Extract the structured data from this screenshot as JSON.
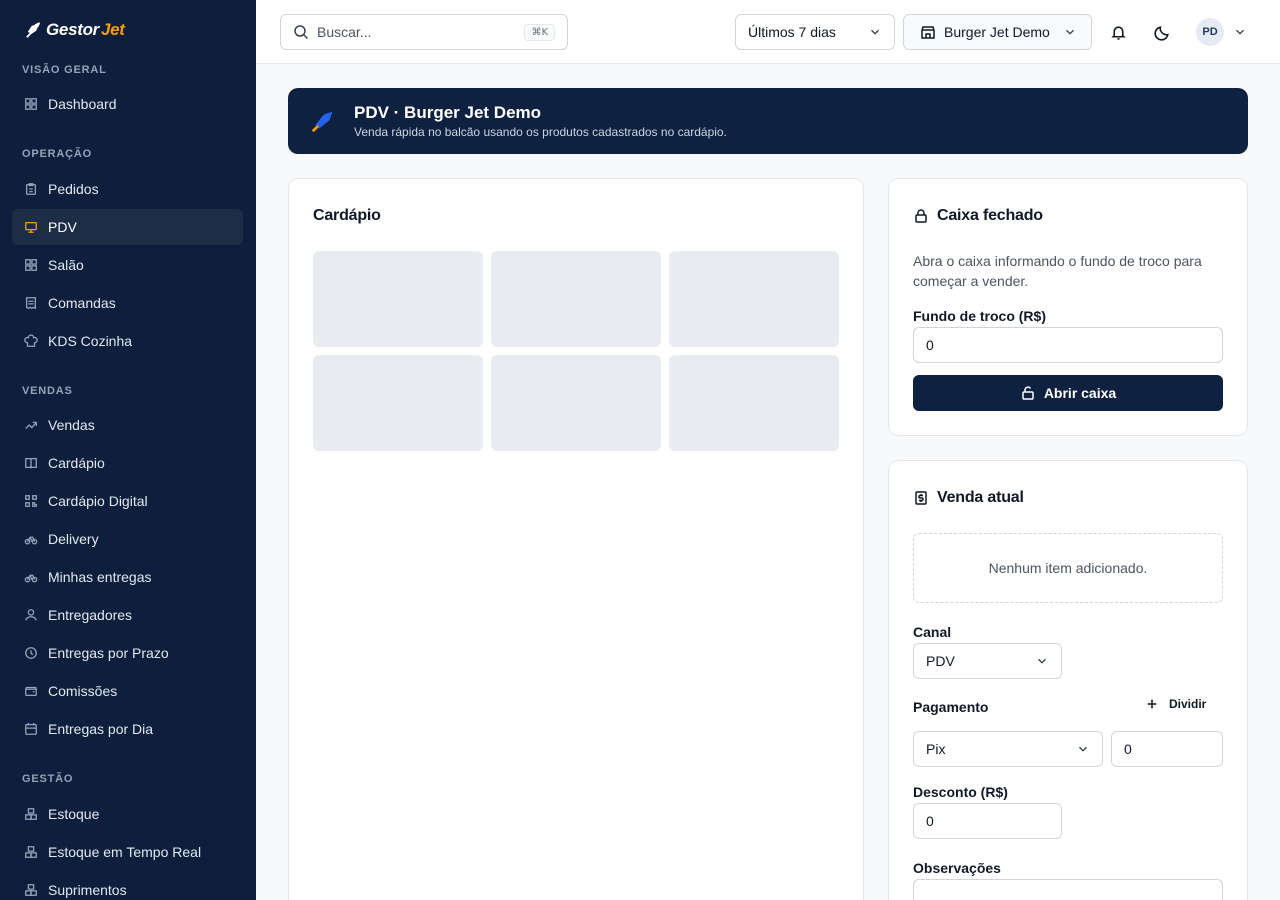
{
  "brand": {
    "name_part1": "Gestor",
    "name_part2": "Jet"
  },
  "sidebar": {
    "sections": [
      {
        "label": "VISÃO GERAL",
        "items": [
          {
            "label": "Dashboard",
            "icon": "dashboard-icon"
          }
        ]
      },
      {
        "label": "OPERAÇÃO",
        "items": [
          {
            "label": "Pedidos",
            "icon": "clipboard-icon"
          },
          {
            "label": "PDV",
            "icon": "monitor-icon",
            "active": true
          },
          {
            "label": "Salão",
            "icon": "grid-icon"
          },
          {
            "label": "Comandas",
            "icon": "receipt-icon"
          },
          {
            "label": "KDS Cozinha",
            "icon": "chef-hat-icon"
          }
        ]
      },
      {
        "label": "VENDAS",
        "items": [
          {
            "label": "Vendas",
            "icon": "trend-icon"
          },
          {
            "label": "Cardápio",
            "icon": "book-icon"
          },
          {
            "label": "Cardápio Digital",
            "icon": "qr-icon"
          },
          {
            "label": "Delivery",
            "icon": "bike-icon"
          },
          {
            "label": "Minhas entregas",
            "icon": "bike-icon"
          },
          {
            "label": "Entregadores",
            "icon": "user-icon"
          },
          {
            "label": "Entregas por Prazo",
            "icon": "clock-icon"
          },
          {
            "label": "Comissões",
            "icon": "wallet-icon"
          },
          {
            "label": "Entregas por Dia",
            "icon": "calendar-icon"
          }
        ]
      },
      {
        "label": "GESTÃO",
        "items": [
          {
            "label": "Estoque",
            "icon": "boxes-icon"
          },
          {
            "label": "Estoque em Tempo Real",
            "icon": "boxes-icon"
          },
          {
            "label": "Suprimentos",
            "icon": "boxes-icon"
          }
        ]
      }
    ]
  },
  "topbar": {
    "search_placeholder": "Buscar...",
    "search_shortcut": "⌘K",
    "period": "Últimos 7 dias",
    "store": "Burger Jet Demo",
    "avatar_initials": "PD"
  },
  "banner": {
    "title": "PDV · Burger Jet Demo",
    "subtitle": "Venda rápida no balcão usando os produtos cadastrados no cardápio."
  },
  "menu_card": {
    "title": "Cardápio"
  },
  "cash_card": {
    "title": "Caixa fechado",
    "description": "Abra o caixa informando o fundo de troco para começar a vender.",
    "fund_label": "Fundo de troco (R$)",
    "fund_value": "0",
    "open_button": "Abrir caixa"
  },
  "sale_card": {
    "title": "Venda atual",
    "empty_text": "Nenhum item adicionado.",
    "channel_label": "Canal",
    "channel_value": "PDV",
    "payment_label": "Pagamento",
    "split_label": "Dividir",
    "payment_method": "Pix",
    "payment_amount": "0",
    "discount_label": "Desconto (R$)",
    "discount_value": "0",
    "notes_label": "Observações"
  },
  "colors": {
    "sidebar_bg": "#0d1f3c",
    "accent": "#f59e0b",
    "primary": "#0f2140"
  }
}
